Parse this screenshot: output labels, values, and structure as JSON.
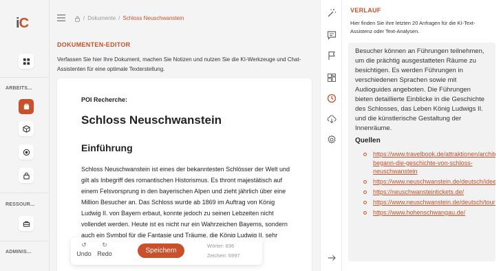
{
  "app": {
    "logo_text": "iC",
    "logo_accent": "#c8502a"
  },
  "breadcrumb": {
    "home_icon": "lock-icon",
    "parent": "Dokumente",
    "current": "Schloss Neuschwanstein",
    "separator": "/"
  },
  "rail": {
    "sections": [
      {
        "label": "ARBEITS..."
      },
      {
        "label": "RESSOUR..."
      },
      {
        "label": "ADMINIS..."
      }
    ],
    "items": [
      {
        "icon": "dashboard-grid-icon",
        "state": "normal"
      },
      {
        "icon": "documents-icon",
        "state": "active"
      },
      {
        "icon": "ai-cube-icon",
        "state": "normal"
      },
      {
        "icon": "target-icon",
        "state": "normal"
      },
      {
        "icon": "lock-icon",
        "state": "normal"
      },
      {
        "icon": "resources-box-icon",
        "state": "normal"
      }
    ]
  },
  "editor": {
    "title": "DOKUMENTEN-EDITOR",
    "description": "Verfassen Sie hier Ihre Dokument, machen Sie Notizen und nutzen Sie die KI-Werkzeuge und Chat-Assistenten für eine optimale Texterstellung."
  },
  "document": {
    "label": "POI Recherche:",
    "heading": "Schloss Neuschwanstein",
    "subheading": "Einführung",
    "body": "Schloss Neuschwanstein ist eines der bekanntesten Schlösser der Welt und gilt als Inbegriff des romantischen Historismus. Es thront majestätisch auf einem Felsvorsprung in den bayerischen Alpen und zieht jährlich über eine Million Besucher an. Das Schloss wurde ab 1869 im Auftrag von König Ludwig II. von Bayern erbaut, konnte jedoch zu seinen Lebzeiten nicht vollendet werden. Heute ist es nicht nur ein Wahrzeichen Bayerns, sondern auch ein Symbol für die Fantasie und Träume, die König Ludwig II. sehr bewunderte."
  },
  "actions": {
    "undo_label": "Undo",
    "redo_label": "Redo",
    "undo_icon": "↺",
    "redo_icon": "↻",
    "save_label": "Speichern",
    "words_label": "Wörter: 836",
    "chars_label": "Zeichen: 6997"
  },
  "tools": [
    {
      "icon": "magic-wand-icon",
      "active": false
    },
    {
      "icon": "chat-icon",
      "active": false
    },
    {
      "icon": "flag-icon",
      "active": false
    },
    {
      "icon": "layout-icon",
      "active": false
    },
    {
      "icon": "history-clock-icon",
      "active": true
    },
    {
      "icon": "cloud-download-icon",
      "active": false
    },
    {
      "icon": "settings-gear-icon",
      "active": false
    },
    {
      "icon": "collapse-arrow-icon",
      "active": false
    }
  ],
  "history": {
    "title": "VERLAUF",
    "description": "Hier finden Sie ihre letzten 20 Anfragen für die KI-Text-Assistenz oder Text-Analysen.",
    "entry_text": "Besucher können an Führungen teilnehmen, um die prächtig ausgestatteten Räume zu besichtigen. Es werden Führungen in verschiedenen Sprachen sowie mit Audioguides angeboten. Die Führungen bieten detaillierte Einblicke in die Geschichte des Schlosses, das Leben König Ludwigs II. und die künstlerische Gestaltung der Innenräume.",
    "sources_title": "Quellen",
    "sources": [
      "https://www.travelbook.de/attraktionen/architektur/so-begann-die-geschichte-von-schloss-neuschwanstein",
      "https://www.neuschwanstein.de/deutsch/idee/index.htm",
      "https://neuschwansteintickets.de/",
      "https://www.neuschwanstein.de/deutsch/tourist/oeffnung.htm",
      "https://www.hohenschwangau.de/"
    ]
  }
}
